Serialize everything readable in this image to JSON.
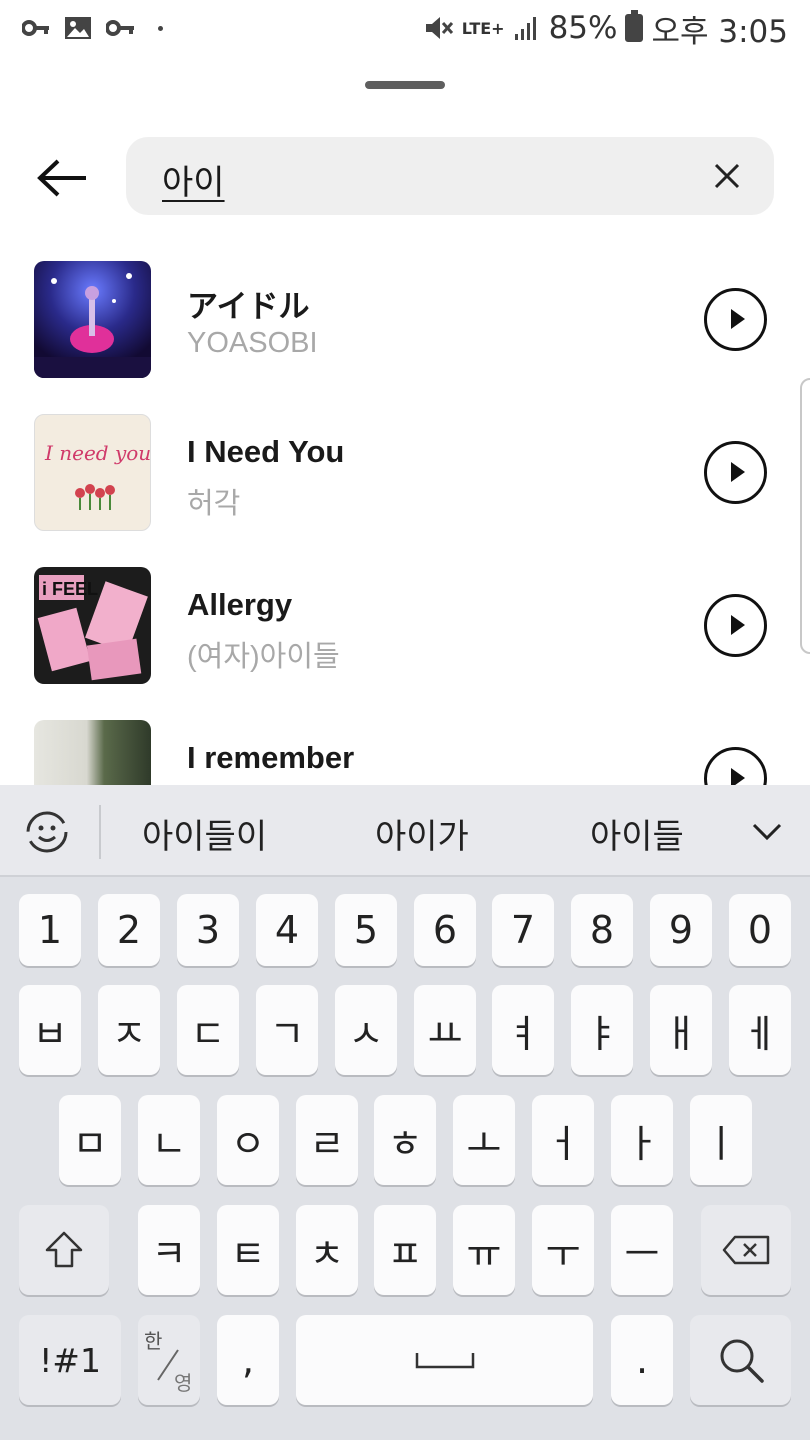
{
  "status_bar": {
    "left_icons": [
      "key-icon",
      "image-icon",
      "key-icon",
      "dot-icon"
    ],
    "network": "LTE+",
    "battery": "85%",
    "time": "오후 3:05"
  },
  "search": {
    "query": "아이"
  },
  "results": [
    {
      "title": "アイドル",
      "artist": "YOASOBI"
    },
    {
      "title": "I Need You",
      "artist": "허각"
    },
    {
      "title": "Allergy",
      "artist": "(여자)아이들"
    },
    {
      "title": "I remember",
      "artist": ""
    }
  ],
  "keyboard": {
    "suggestions": [
      "아이들이",
      "아이가",
      "아이들"
    ],
    "row_numbers": [
      "1",
      "2",
      "3",
      "4",
      "5",
      "6",
      "7",
      "8",
      "9",
      "0"
    ],
    "row1": [
      "ㅂ",
      "ㅈ",
      "ㄷ",
      "ㄱ",
      "ㅅ",
      "ㅛ",
      "ㅕ",
      "ㅑ",
      "ㅐ",
      "ㅔ"
    ],
    "row2": [
      "ㅁ",
      "ㄴ",
      "ㅇ",
      "ㄹ",
      "ㅎ",
      "ㅗ",
      "ㅓ",
      "ㅏ",
      "ㅣ"
    ],
    "row3": [
      "ㅋ",
      "ㅌ",
      "ㅊ",
      "ㅍ",
      "ㅠ",
      "ㅜ",
      "ㅡ"
    ],
    "symbols_label": "!#1",
    "lang_top": "한",
    "lang_bottom": "영",
    "comma": ",",
    "period": "."
  }
}
